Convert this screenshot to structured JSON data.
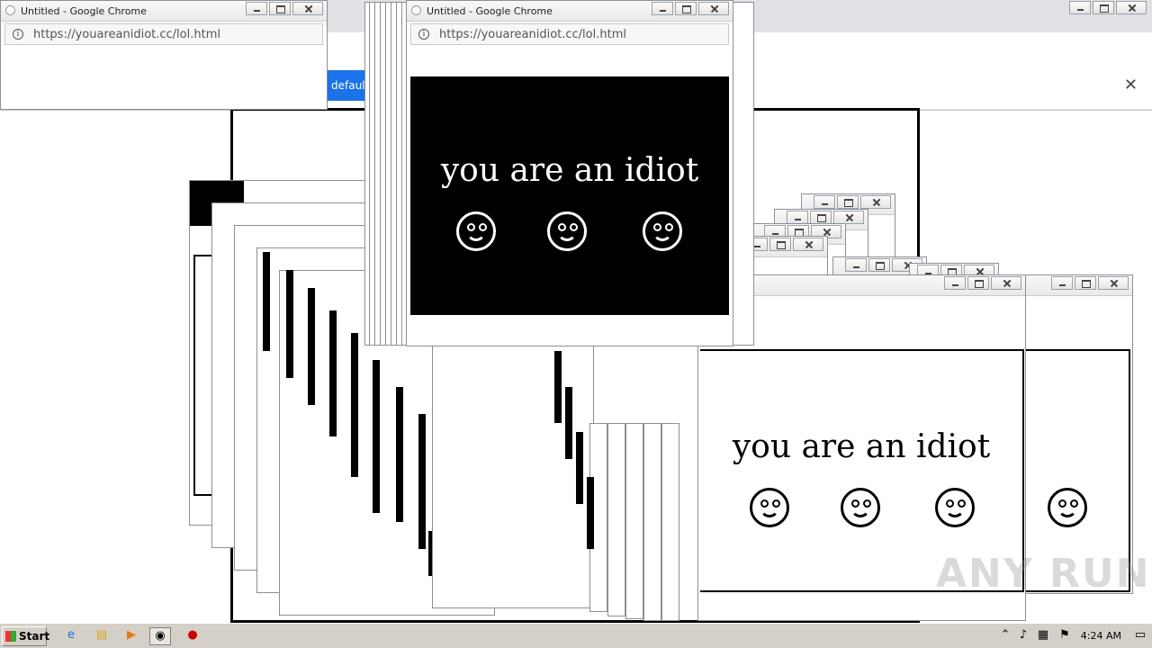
{
  "popup": {
    "title": "Untitled - Google Chrome",
    "url": "https://youareanidiot.cc/lol.html",
    "message": "you are an idiot"
  },
  "background_browser": {
    "infobar_button": "default"
  },
  "taskbar": {
    "start_label": "Start",
    "clock": "4:24 AM",
    "apps": [
      "ie-icon",
      "explorer-icon",
      "media-player-icon",
      "chrome-icon",
      "stop-icon"
    ]
  },
  "watermark": "ANY RUN",
  "colors": {
    "popup_panel": "#000000",
    "taskbar": "#d4d0c8",
    "infobar_button": "#1a73e8"
  }
}
